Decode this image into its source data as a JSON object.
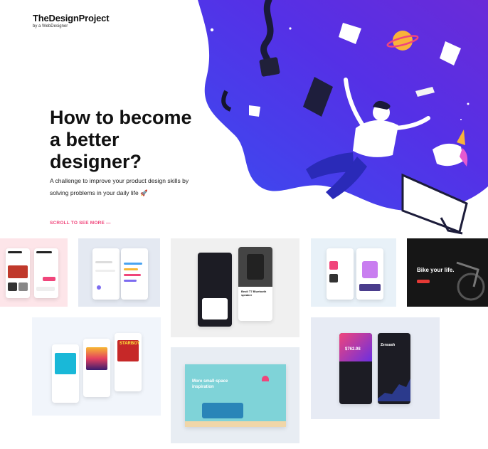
{
  "header": {
    "brand": "TheDesignProject",
    "tagline": "by a WebDesigner"
  },
  "hero": {
    "title_lines": [
      "How to become",
      "a better",
      "designer?"
    ],
    "subtitle": "A challenge to improve your product design skills by solving problems in your daily life 🚀",
    "scroll_label": "SCROLL TO SEE MORE —"
  },
  "gallery": {
    "bike": {
      "headline": "Bike your life."
    },
    "sofa": {
      "headline": "More small-space inspiration"
    },
    "crypto": {
      "brand": "Zensash",
      "amount": "$762.98"
    },
    "speaker": {
      "title": "Beoli T7 Bluetooth speaker"
    },
    "music": {
      "cover_text": "STARBOY"
    }
  },
  "colors": {
    "accent": "#f0457b",
    "illustration_blue": "#4d2ee8",
    "illustration_purple": "#6b2fe0"
  }
}
